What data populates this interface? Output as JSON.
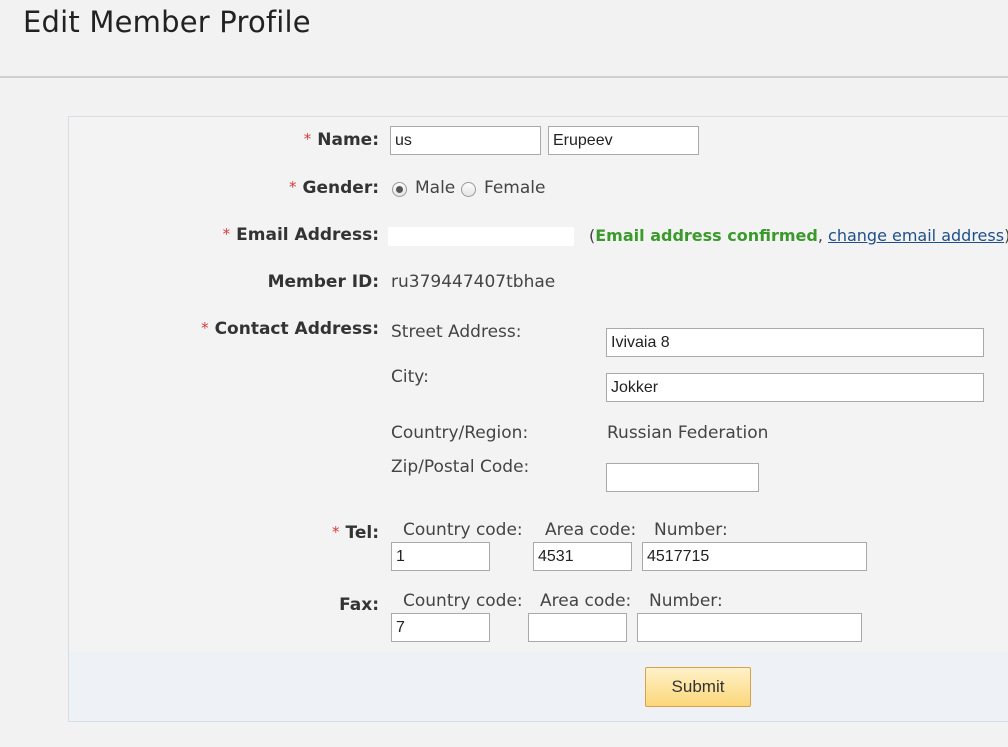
{
  "page": {
    "title": "Edit Member Profile"
  },
  "form": {
    "required_mark": "*",
    "name": {
      "label": "Name:",
      "first": "us",
      "last": "Erupeev"
    },
    "gender": {
      "label": "Gender:",
      "options": [
        "Male",
        "Female"
      ],
      "selected": "Male"
    },
    "email": {
      "label": "Email Address:",
      "open_paren": "(",
      "status": "Email address confirmed",
      "comma": ",",
      "change_link": "change email address",
      "close_paren": ")"
    },
    "member_id": {
      "label": "Member ID:",
      "value": "ru379447407tbhae"
    },
    "contact": {
      "label": "Contact Address:",
      "street_label": "Street Address:",
      "street_value": "Ivivaia 8",
      "city_label": "City:",
      "city_value": "Jokker",
      "country_label": "Country/Region:",
      "country_value": "Russian Federation",
      "zip_label": "Zip/Postal Code:",
      "zip_value": ""
    },
    "tel": {
      "label": "Tel:",
      "country_code_label": "Country code:",
      "area_code_label": "Area code:",
      "number_label": "Number:",
      "country_code": "1",
      "area_code": "4531",
      "number": "4517715"
    },
    "fax": {
      "label": "Fax:",
      "country_code_label": "Country code:",
      "area_code_label": "Area code:",
      "number_label": "Number:",
      "country_code": "7",
      "area_code": "",
      "number": ""
    },
    "submit_label": "Submit"
  },
  "colors": {
    "required": "#d83a3a",
    "confirmed": "#3a9a2b",
    "link": "#1f4f8a",
    "submit_bg": "#fbd77a"
  }
}
